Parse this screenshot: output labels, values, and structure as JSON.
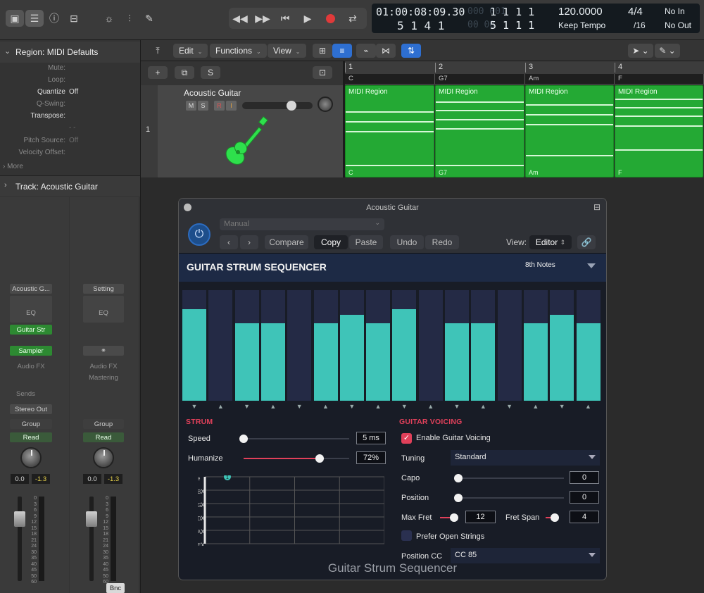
{
  "toolbar": {
    "lcd": {
      "time": "01:00:08:09.30",
      "beats_top": "1 1 1 1",
      "beats_top_dim": "000 001",
      "bars_bottom": "5 1 4 1",
      "bars_bottom_dim": "00 00",
      "beats_bottom": "5 1 1 1",
      "tempo": "120.0000",
      "tempo_mode": "Keep Tempo",
      "signature": "4/4",
      "division": "/16",
      "in": "No In",
      "out": "No Out"
    }
  },
  "inspector": {
    "region_header": "Region:",
    "region_name": "MIDI Defaults",
    "rows": [
      {
        "label": "Mute:",
        "value": ""
      },
      {
        "label": "Loop:",
        "value": ""
      },
      {
        "label": "Quantize",
        "value": "Off"
      },
      {
        "label": "Q-Swing:",
        "value": ""
      },
      {
        "label": "Transpose:",
        "value": ""
      },
      {
        "label": "",
        "value": "- -"
      },
      {
        "label": "Pitch Source:",
        "value": "Off"
      },
      {
        "label": "Velocity Offset:",
        "value": ""
      }
    ],
    "more": "More",
    "track_header": "Track:",
    "track_name": "Acoustic Guitar"
  },
  "strips": {
    "left": {
      "setting": "Acoustic G...",
      "eq": "EQ",
      "midi_fx": "Guitar Str",
      "instrument": "Sampler",
      "audio_fx": "Audio FX",
      "sends": "Sends",
      "output": "Stereo Out",
      "group": "Group",
      "automation": "Read",
      "vol": "0.0",
      "peak": "-1.3"
    },
    "right": {
      "setting": "Setting",
      "eq": "EQ",
      "audio_fx": "Audio FX",
      "audio_fx2": "Mastering",
      "group": "Group",
      "automation": "Read",
      "vol": "0.0",
      "peak": "-1.3",
      "name": "Bnc"
    },
    "scale": [
      "0",
      "3",
      "6",
      "9",
      "12",
      "15",
      "18",
      "21",
      "24",
      "30",
      "35",
      "40",
      "45",
      "50",
      "60"
    ]
  },
  "tracks_toolbar": {
    "edit": "Edit",
    "functions": "Functions",
    "view": "View",
    "s_button": "S"
  },
  "track": {
    "number": "1",
    "name": "Acoustic Guitar",
    "m": "M",
    "s": "S",
    "r": "R",
    "i": "I"
  },
  "ruler": {
    "bars": [
      "1",
      "2",
      "3",
      "4"
    ],
    "chords": [
      "C",
      "G7",
      "Am",
      "F"
    ]
  },
  "regions": [
    {
      "title": "MIDI Region",
      "chord": "C"
    },
    {
      "title": "MIDI Region",
      "chord": "G7"
    },
    {
      "title": "MIDI Region",
      "chord": "Am"
    },
    {
      "title": "MIDI Region",
      "chord": "F"
    }
  ],
  "plugin": {
    "window_title": "Acoustic Guitar",
    "preset": "Manual",
    "compare": "Compare",
    "copy": "Copy",
    "paste": "Paste",
    "undo": "Undo",
    "redo": "Redo",
    "view_label": "View:",
    "view_value": "Editor",
    "seq_title": "GUITAR STRUM SEQUENCER",
    "note_value": "8th Notes",
    "steps": [
      {
        "level": 0.83,
        "dir": "down"
      },
      {
        "level": 0,
        "dir": "up"
      },
      {
        "level": 0.7,
        "dir": "down"
      },
      {
        "level": 0.7,
        "dir": "up"
      },
      {
        "level": 0,
        "dir": "down"
      },
      {
        "level": 0.7,
        "dir": "up"
      },
      {
        "level": 0.78,
        "dir": "down"
      },
      {
        "level": 0.7,
        "dir": "up"
      },
      {
        "level": 0.83,
        "dir": "down"
      },
      {
        "level": 0,
        "dir": "up"
      },
      {
        "level": 0.7,
        "dir": "down"
      },
      {
        "level": 0.7,
        "dir": "up"
      },
      {
        "level": 0,
        "dir": "down"
      },
      {
        "level": 0.7,
        "dir": "up"
      },
      {
        "level": 0.78,
        "dir": "down"
      },
      {
        "level": 0.7,
        "dir": "up"
      }
    ],
    "strum": {
      "section": "STRUM",
      "speed_label": "Speed",
      "speed_value": "5 ms",
      "speed_level": 0,
      "humanize_label": "Humanize",
      "humanize_value": "72%",
      "humanize_level": 0.72,
      "strings": [
        "e",
        "B",
        "G",
        "D",
        "A",
        "E"
      ],
      "marks": [
        "",
        "X",
        "X",
        "X",
        "X",
        "X"
      ],
      "fret_marker": "1"
    },
    "voicing": {
      "section": "GUITAR VOICING",
      "enable_label": "Enable Guitar Voicing",
      "enabled": true,
      "tuning_label": "Tuning",
      "tuning_value": "Standard",
      "capo_label": "Capo",
      "capo_value": "0",
      "position_label": "Position",
      "position_value": "0",
      "max_fret_label": "Max Fret",
      "max_fret_value": "12",
      "fret_span_label": "Fret Span",
      "fret_span_value": "4",
      "open_strings_label": "Prefer Open Strings",
      "position_cc_label": "Position CC",
      "position_cc_value": "CC 85"
    },
    "footer": "Guitar Strum Sequencer"
  }
}
